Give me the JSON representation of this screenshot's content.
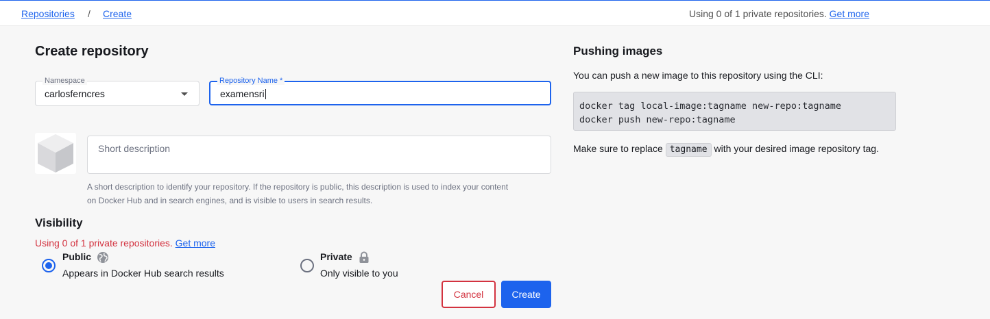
{
  "breadcrumb": {
    "repositories": "Repositories",
    "separator": "/",
    "create": "Create"
  },
  "top_usage": {
    "text": "Using 0 of 1 private repositories.",
    "link": "Get more"
  },
  "form": {
    "title": "Create repository",
    "namespace": {
      "label": "Namespace",
      "value": "carlosferncres"
    },
    "repo_name": {
      "label": "Repository Name *",
      "value": "examensri"
    },
    "description": {
      "placeholder": "Short description",
      "helper_line1": "A short description to identify your repository. If the repository is public, this description is used to index your content",
      "helper_line2": "on Docker Hub and in search engines, and is visible to users in search results."
    },
    "visibility": {
      "title": "Visibility",
      "usage_text": "Using 0 of 1 private repositories.",
      "usage_link": "Get more",
      "public": {
        "title": "Public",
        "subtitle": "Appears in Docker Hub search results",
        "selected": true,
        "icon": "globe-icon"
      },
      "private": {
        "title": "Private",
        "subtitle": "Only visible to you",
        "selected": false,
        "icon": "lock-icon"
      }
    },
    "cancel_label": "Cancel",
    "create_label": "Create"
  },
  "push": {
    "title": "Pushing images",
    "intro": "You can push a new image to this repository using the CLI:",
    "code": [
      "docker tag local-image:tagname new-repo:tagname",
      "docker push new-repo:tagname"
    ],
    "note_before": "Make sure to replace",
    "note_code": "tagname",
    "note_after": "with your desired image repository tag."
  },
  "colors": {
    "accent": "#1d63ed",
    "danger": "#d3323f",
    "background": "#f7f7f7"
  }
}
